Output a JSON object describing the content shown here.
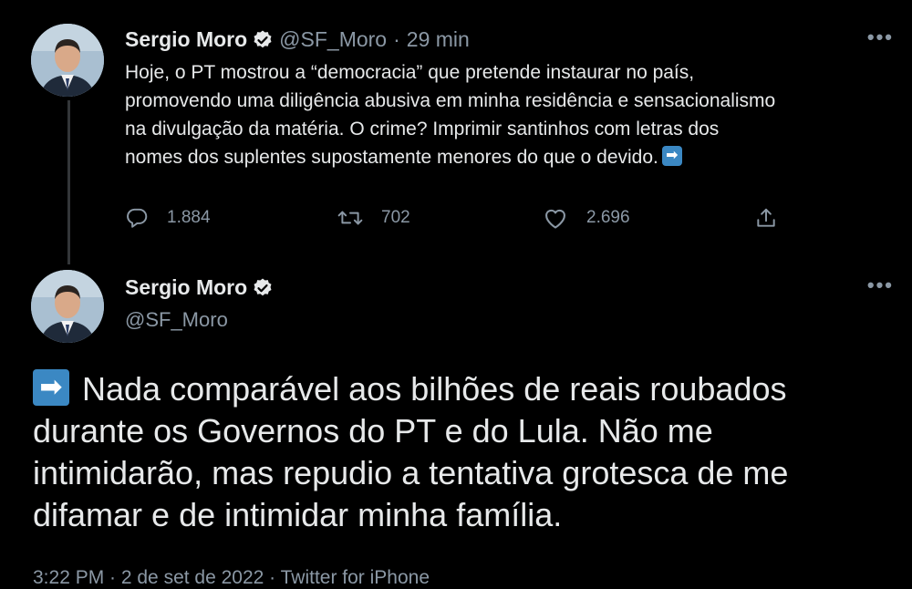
{
  "tweet1": {
    "author_name": "Sergio Moro",
    "handle": "@SF_Moro",
    "separator": "·",
    "time": "29 min",
    "text_lines": [
      "Hoje, o PT mostrou a “democracia” que pretende instaurar no país,",
      "promovendo uma diligência abusiva em minha residência e sensacionalismo",
      "na divulgação da matéria. O crime? Imprimir santinhos com letras dos",
      "nomes dos suplentes supostamente menores do que o devido."
    ],
    "arrow_emoji": "➡",
    "more_icon": "•••",
    "counts": {
      "replies": "1.884",
      "retweets": "702",
      "likes": "2.696"
    }
  },
  "tweet2": {
    "author_name": "Sergio Moro",
    "handle": "@SF_Moro",
    "arrow_emoji": "➡",
    "more_icon": "•••",
    "text_lines": [
      "Nada comparável aos bilhões de reais roubados",
      "durante os Governos do PT e do Lula. Não me",
      "intimidarão, mas repudio a tentativa grotesca de me",
      "difamar e de intimidar minha família."
    ],
    "meta": "3:22 PM · 2 de set de 2022 · Twitter for iPhone"
  },
  "colors": {
    "background": "#000000",
    "text": "#e7e9ea",
    "secondary": "#8b98a5",
    "verified": "#e7e9ea",
    "emoji_blue": "#3b88c3",
    "thread_line": "#333639"
  },
  "icons": {
    "reply": "reply-icon",
    "retweet": "retweet-icon",
    "like": "heart-icon",
    "share": "share-icon",
    "verified": "verified-badge-icon"
  }
}
